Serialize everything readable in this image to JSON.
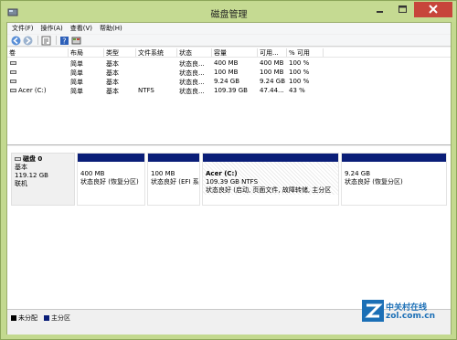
{
  "window": {
    "title": "磁盘管理"
  },
  "menu": [
    "文件(F)",
    "操作(A)",
    "查看(V)",
    "帮助(H)"
  ],
  "toolbar": {
    "icons": [
      "back-icon",
      "forward-icon",
      "properties-icon",
      "help-icon",
      "disk-icon"
    ]
  },
  "volumes": {
    "columns": [
      "卷",
      "布局",
      "类型",
      "文件系统",
      "状态",
      "容量",
      "可用...",
      "% 可用"
    ],
    "rows": [
      {
        "name": "",
        "layout": "简单",
        "type": "基本",
        "fs": "",
        "status": "状态良...",
        "capacity": "400 MB",
        "free": "400 MB",
        "pct": "100 %"
      },
      {
        "name": "",
        "layout": "简单",
        "type": "基本",
        "fs": "",
        "status": "状态良...",
        "capacity": "100 MB",
        "free": "100 MB",
        "pct": "100 %"
      },
      {
        "name": "",
        "layout": "简单",
        "type": "基本",
        "fs": "",
        "status": "状态良...",
        "capacity": "9.24 GB",
        "free": "9.24 GB",
        "pct": "100 %"
      },
      {
        "name": "Acer (C:)",
        "layout": "简单",
        "type": "基本",
        "fs": "NTFS",
        "status": "状态良...",
        "capacity": "109.39 GB",
        "free": "47.44...",
        "pct": "43 %"
      }
    ]
  },
  "disk": {
    "name": "磁盘 0",
    "type": "基本",
    "size": "119.12 GB",
    "state": "联机",
    "partitions": [
      {
        "name": "",
        "size": "400 MB",
        "status": "状态良好 (恢复分区)"
      },
      {
        "name": "",
        "size": "100 MB",
        "status": "状态良好 (EFI 系"
      },
      {
        "name": "Acer  (C:)",
        "size": "109.39 GB NTFS",
        "status": "状态良好 (启动, 页面文件, 故障转储, 主分区"
      },
      {
        "name": "",
        "size": "9.24 GB",
        "status": "状态良好 (恢复分区)"
      }
    ]
  },
  "legend": [
    {
      "label": "未分配",
      "color": "#000000"
    },
    {
      "label": "主分区",
      "color": "#0a1e78"
    }
  ],
  "watermark": {
    "title": "中关村在线",
    "url": "zol.com.cn"
  }
}
